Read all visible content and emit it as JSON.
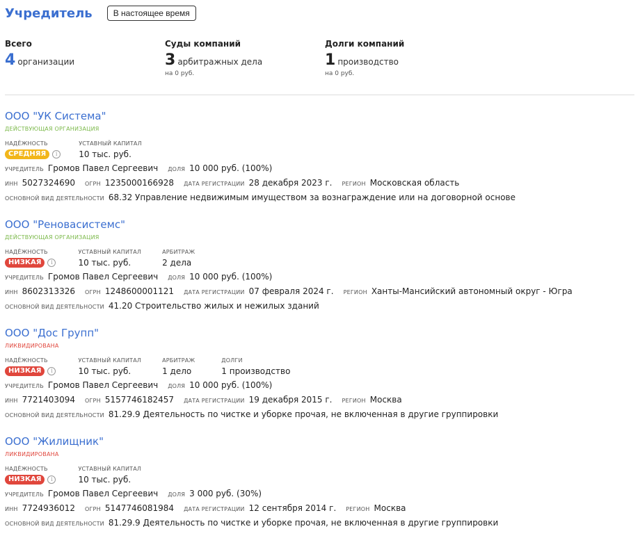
{
  "header": {
    "title": "Учредитель",
    "period_button": "В настоящее время"
  },
  "stats": [
    {
      "label": "Всего",
      "number": "4",
      "text": "организации",
      "sub": ""
    },
    {
      "label": "Суды компаний",
      "number": "3",
      "text": "арбитражных дела",
      "sub": "на 0 руб."
    },
    {
      "label": "Долги компаний",
      "number": "1",
      "text": "производство",
      "sub": "на 0 руб."
    }
  ],
  "labels": {
    "reliability": "НАДЁЖНОСТЬ",
    "capital": "УСТАВНЫЙ КАПИТАЛ",
    "arbitration": "АРБИТРАЖ",
    "debts": "ДОЛГИ",
    "founder": "УЧРЕДИТЕЛЬ",
    "share": "ДОЛЯ",
    "inn": "ИНН",
    "ogrn": "ОГРН",
    "reg_date": "ДАТА РЕГИСТРАЦИИ",
    "region": "РЕГИОН",
    "activity": "ОСНОВНОЙ ВИД ДЕЯТЕЛЬНОСТИ"
  },
  "orgs": [
    {
      "name": "ООО \"УК Система\"",
      "status": "ДЕЙСТВУЮЩАЯ ОРГАНИЗАЦИЯ",
      "reliability": "СРЕДНЯЯ",
      "capital": "10 тыс. руб.",
      "arbitration": "",
      "debts": "",
      "founder": "Громов Павел Сергеевич",
      "share": "10 000 руб. (100%)",
      "inn": "5027324690",
      "ogrn": "1235000166928",
      "reg_date": "28 декабря 2023 г.",
      "region": "Московская область",
      "activity": "68.32 Управление недвижимым имуществом за вознаграждение или на договорной основе"
    },
    {
      "name": "ООО \"Реновасистемс\"",
      "status": "ДЕЙСТВУЮЩАЯ ОРГАНИЗАЦИЯ",
      "reliability": "НИЗКАЯ",
      "capital": "10 тыс. руб.",
      "arbitration": "2 дела",
      "debts": "",
      "founder": "Громов Павел Сергеевич",
      "share": "10 000 руб. (100%)",
      "inn": "8602313326",
      "ogrn": "1248600001121",
      "reg_date": "07 февраля 2024 г.",
      "region": "Ханты-Мансийский автономный округ - Югра",
      "activity": "41.20 Строительство жилых и нежилых зданий"
    },
    {
      "name": "ООО \"Дос Групп\"",
      "status": "ЛИКВИДИРОВАНА",
      "reliability": "НИЗКАЯ",
      "capital": "10 тыс. руб.",
      "arbitration": "1 дело",
      "debts": "1 производство",
      "founder": "Громов Павел Сергеевич",
      "share": "10 000 руб. (100%)",
      "inn": "7721403094",
      "ogrn": "5157746182457",
      "reg_date": "19 декабря 2015 г.",
      "region": "Москва",
      "activity": "81.29.9 Деятельность по чистке и уборке прочая, не включенная в другие группировки"
    },
    {
      "name": "ООО \"Жилищник\"",
      "status": "ЛИКВИДИРОВАНА",
      "reliability": "НИЗКАЯ",
      "capital": "10 тыс. руб.",
      "arbitration": "",
      "debts": "",
      "founder": "Громов Павел Сергеевич",
      "share": "3 000 руб. (30%)",
      "inn": "7724936012",
      "ogrn": "5147746081984",
      "reg_date": "12 сентября 2014 г.",
      "region": "Москва",
      "activity": "81.29.9 Деятельность по чистке и уборке прочая, не включенная в другие группировки"
    }
  ],
  "colors": {
    "accent": "#3b6fd0",
    "active": "#7ab848",
    "liquidated": "#e0463c",
    "badge_mid": "#f2b61a",
    "badge_low": "#e0463c"
  }
}
